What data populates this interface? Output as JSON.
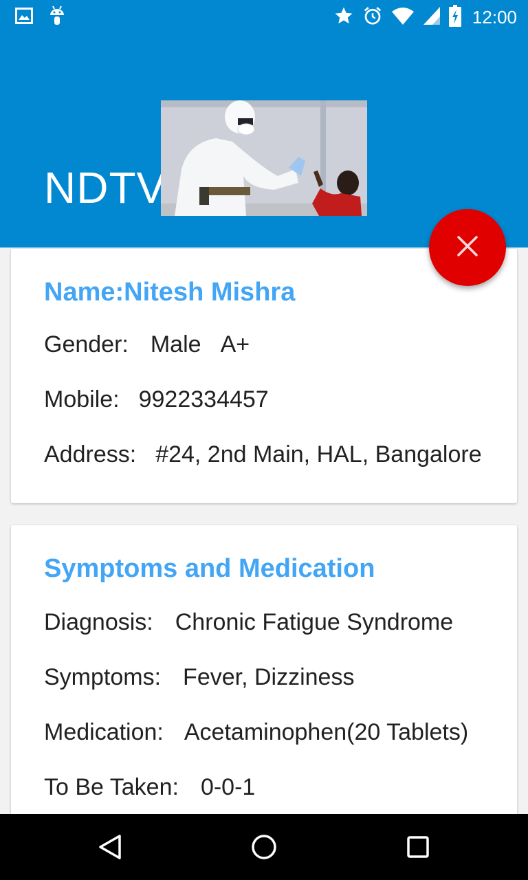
{
  "status_bar": {
    "time": "12:00",
    "left_icons": [
      "image-icon",
      "android-icon"
    ],
    "right_icons": [
      "star-icon",
      "alarm-icon",
      "wifi-icon",
      "signal-icon",
      "battery-charging-icon"
    ]
  },
  "app_bar": {
    "title": "NDTV",
    "background_color": "#0288d1"
  },
  "fab": {
    "icon": "close-icon",
    "color": "#e00000"
  },
  "patient_card": {
    "name_label": "Name:",
    "name_value": "Nitesh Mishra",
    "gender_label": "Gender:",
    "gender_value": "Male",
    "blood_group": "A+",
    "mobile_label": "Mobile:",
    "mobile_value": "9922334457",
    "address_label": "Address:",
    "address_value": "#24, 2nd Main, HAL, Bangalore"
  },
  "medical_card": {
    "heading": "Symptoms and Medication",
    "diagnosis_label": "Diagnosis:",
    "diagnosis_value": "Chronic Fatigue Syndrome",
    "symptoms_label": "Symptoms:",
    "symptoms_value": "Fever, Dizziness",
    "medication_label": "Medication:",
    "medication_value": "Acetaminophen(20 Tablets)",
    "dosage_label": "To Be Taken:",
    "dosage_value": "0-0-1"
  },
  "nav_bar": {
    "buttons": [
      "back-icon",
      "home-icon",
      "recents-icon"
    ]
  },
  "colors": {
    "accent": "#42a5f5",
    "primary": "#0288d1",
    "fab": "#e00000"
  }
}
